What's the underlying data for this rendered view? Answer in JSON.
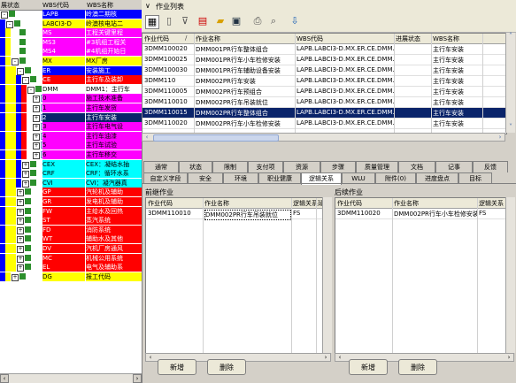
{
  "left_tree": {
    "headers": [
      "展状态",
      "WBS代码",
      "WBS名称"
    ],
    "rows": [
      {
        "indent": 0,
        "code": "LAPB",
        "name": "岭澳二期核",
        "bg": "#0000ff",
        "fg": "#ffffff",
        "toggle": "-"
      },
      {
        "indent": 1,
        "code": "LABCI3-D",
        "name": "岭澳核电站二",
        "bg": "#ffff00",
        "fg": "#000000",
        "toggle": "-"
      },
      {
        "indent": 2,
        "code": "MS",
        "name": "工程关键里程",
        "bg": "#ff00ff",
        "fg": "#ffffff",
        "toggle": ""
      },
      {
        "indent": 2,
        "code": "MS3",
        "name": "#3机组工程关",
        "bg": "#ff00ff",
        "fg": "#ffffff",
        "toggle": ""
      },
      {
        "indent": 2,
        "code": "MS4",
        "name": "#4机组开始日",
        "bg": "#ff00ff",
        "fg": "#ffffff",
        "toggle": ""
      },
      {
        "indent": 2,
        "code": "MX",
        "name": "MX厂房",
        "bg": "#ffff00",
        "fg": "#000000",
        "toggle": "-"
      },
      {
        "indent": 3,
        "code": "ER",
        "name": "安装施工",
        "bg": "#0000ff",
        "fg": "#ffffff",
        "toggle": "-"
      },
      {
        "indent": 4,
        "code": "CE",
        "name": "主行车及装卸",
        "bg": "#ff0000",
        "fg": "#ffffff",
        "toggle": "-"
      },
      {
        "indent": 5,
        "code": "DMM",
        "name": "DMM1：主行车",
        "bg": "#ffffff",
        "fg": "#000000",
        "toggle": "-"
      },
      {
        "indent": 6,
        "code": "0",
        "name": "施工技术准备",
        "bg": "#ff00ff",
        "fg": "#000000",
        "toggle": "+"
      },
      {
        "indent": 6,
        "code": "1",
        "name": "主行车发货",
        "bg": "#ff00ff",
        "fg": "#000000",
        "toggle": "+"
      },
      {
        "indent": 6,
        "code": "2",
        "name": "主行车安装",
        "bg": "#0a246a",
        "fg": "#ffffff",
        "toggle": "+"
      },
      {
        "indent": 6,
        "code": "3",
        "name": "主行车电气设",
        "bg": "#ff00ff",
        "fg": "#000000",
        "toggle": "+"
      },
      {
        "indent": 6,
        "code": "4",
        "name": "主行车油漆",
        "bg": "#ff00ff",
        "fg": "#000000",
        "toggle": "+"
      },
      {
        "indent": 6,
        "code": "5",
        "name": "主行车试验",
        "bg": "#ff00ff",
        "fg": "#000000",
        "toggle": "+"
      },
      {
        "indent": 6,
        "code": "6",
        "name": "主行车移交",
        "bg": "#ff00ff",
        "fg": "#000000",
        "toggle": "+"
      },
      {
        "indent": 4,
        "code": "CEX",
        "name": "CEX：凝结水抽",
        "bg": "#00ffff",
        "fg": "#000000",
        "toggle": "+"
      },
      {
        "indent": 4,
        "code": "CRF",
        "name": "CRF：循环水系",
        "bg": "#00ffff",
        "fg": "#000000",
        "toggle": "+"
      },
      {
        "indent": 4,
        "code": "CVI",
        "name": "CVI：凝汽器真",
        "bg": "#00ffff",
        "fg": "#000000",
        "toggle": "+"
      },
      {
        "indent": 3,
        "code": "GP",
        "name": "汽轮机及辅助",
        "bg": "#ff0000",
        "fg": "#ffffff",
        "toggle": "+"
      },
      {
        "indent": 3,
        "code": "GR",
        "name": "发电机及辅助",
        "bg": "#ff0000",
        "fg": "#ffffff",
        "toggle": "+"
      },
      {
        "indent": 3,
        "code": "FW",
        "name": "主给水及回热",
        "bg": "#ff0000",
        "fg": "#ffffff",
        "toggle": "+"
      },
      {
        "indent": 3,
        "code": "ST",
        "name": "蒸汽系统",
        "bg": "#ff0000",
        "fg": "#ffffff",
        "toggle": "+"
      },
      {
        "indent": 3,
        "code": "FD",
        "name": "消防系统",
        "bg": "#ff0000",
        "fg": "#ffffff",
        "toggle": "+"
      },
      {
        "indent": 3,
        "code": "WT",
        "name": "辅助水及其他",
        "bg": "#ff0000",
        "fg": "#ffffff",
        "toggle": "+"
      },
      {
        "indent": 3,
        "code": "DV",
        "name": "汽机厂房通风",
        "bg": "#ff0000",
        "fg": "#ffffff",
        "toggle": "+"
      },
      {
        "indent": 3,
        "code": "MC",
        "name": "机械公用系统",
        "bg": "#ff0000",
        "fg": "#ffffff",
        "toggle": "+"
      },
      {
        "indent": 3,
        "code": "EL",
        "name": "电气及辅助系",
        "bg": "#ff0000",
        "fg": "#ffffff",
        "toggle": "+"
      },
      {
        "indent": 2,
        "code": "DG",
        "name": "报工代码",
        "bg": "#ffff00",
        "fg": "#000000",
        "toggle": "+"
      }
    ]
  },
  "activity_list": {
    "title": "作业列表",
    "headers": [
      "作业代码",
      "作业名称",
      "WBS代码",
      "进展状态",
      "WBS名称"
    ],
    "rows": [
      {
        "code": "3DMM100020",
        "name": "DMM001PR行车整体组合",
        "wbs": "LAPB.LABCI3-D.MX.ER.CE.DMM.2",
        "status": "",
        "wbs_name": "主行车安装"
      },
      {
        "code": "3DMM100025",
        "name": "DMM001PR行车小车检修安装",
        "wbs": "LAPB.LABCI3-D.MX.ER.CE.DMM.2",
        "status": "",
        "wbs_name": "主行车安装"
      },
      {
        "code": "3DMM100030",
        "name": "DMM001PR行车辅助设备安装",
        "wbs": "LAPB.LABCI3-D.MX.ER.CE.DMM.2",
        "status": "",
        "wbs_name": "主行车安装"
      },
      {
        "code": "3DMM110",
        "name": "DMM002PR行车安装",
        "wbs": "LAPB.LABCI3-D.MX.ER.CE.DMM.2",
        "status": "",
        "wbs_name": "主行车安装"
      },
      {
        "code": "3DMM110005",
        "name": "DMM002PR行车预组合",
        "wbs": "LAPB.LABCI3-D.MX.ER.CE.DMM.2",
        "status": "",
        "wbs_name": "主行车安装"
      },
      {
        "code": "3DMM110010",
        "name": "DMM002PR行车吊装就位",
        "wbs": "LAPB.LABCI3-D.MX.ER.CE.DMM.2",
        "status": "",
        "wbs_name": "主行车安装"
      },
      {
        "code": "3DMM110015",
        "name": "DMM002PR行车整体组合",
        "wbs": "LAPB.LABCI3-D.MX.ER.CE.DMM.2",
        "status": "",
        "wbs_name": "主行车安装",
        "selected": true
      },
      {
        "code": "3DMM110020",
        "name": "DMM002PR行车小车检修安装",
        "wbs": "LAPB.LABCI3-D.MX.ER.CE.DMM.2",
        "status": "",
        "wbs_name": "主行车安装"
      }
    ]
  },
  "tabs_row1": [
    "通常",
    "状态",
    "限制",
    "支付项",
    "资源",
    "步骤",
    "质量管理",
    "文档",
    "记事",
    "反馈"
  ],
  "tabs_row2": [
    "自定义字段",
    "安全",
    "环境",
    "职业健康",
    "逻辑关系",
    "WLU",
    "附件(0)",
    "进度盘点",
    "目标"
  ],
  "active_tab": "逻辑关系",
  "predecessors": {
    "title": "前继作业",
    "headers": [
      "作业代码",
      "作业名称",
      "逻辑关系",
      "延"
    ],
    "rows": [
      {
        "code": "3DMM110010",
        "name": "DMM002PR行车吊装就位",
        "rel": "FS"
      }
    ],
    "add_label": "新增",
    "delete_label": "删除"
  },
  "successors": {
    "title": "后续作业",
    "headers": [
      "作业代码",
      "作业名称",
      "逻辑关系"
    ],
    "rows": [
      {
        "code": "3DMM110020",
        "name": "DMM002PR行车小车检修安装",
        "rel": "FS"
      }
    ],
    "add_label": "新增",
    "delete_label": "删除"
  }
}
